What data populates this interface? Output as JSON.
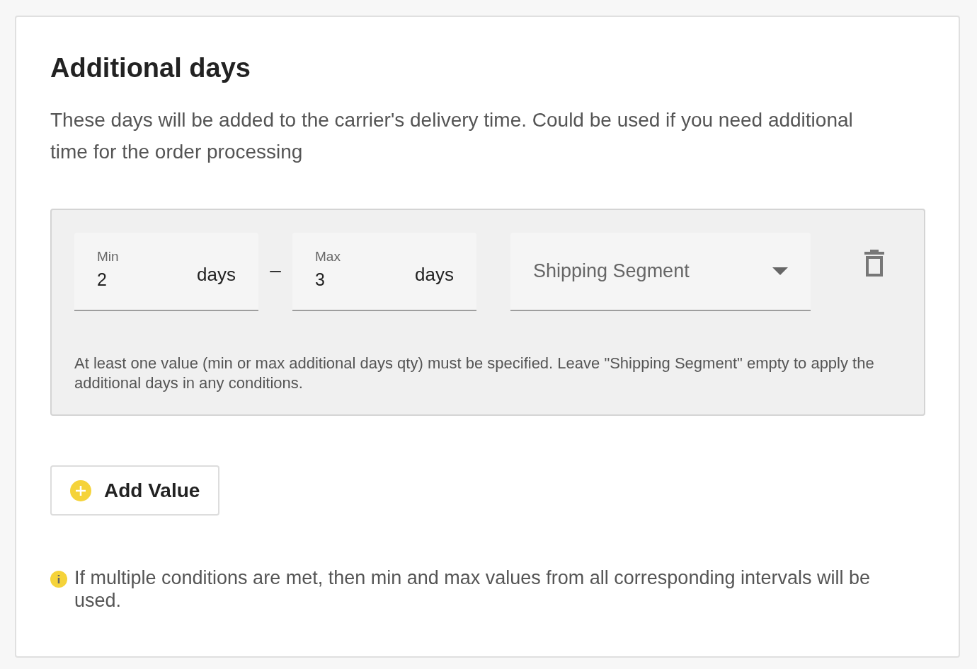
{
  "section": {
    "title": "Additional days",
    "description": "These days will be added to the carrier's delivery time. Could be used if you need additional time for the order processing"
  },
  "intervals": [
    {
      "min": {
        "label": "Min",
        "value": "2",
        "suffix": "days"
      },
      "separator": "–",
      "max": {
        "label": "Max",
        "value": "3",
        "suffix": "days"
      },
      "segment": {
        "placeholder": "Shipping Segment"
      },
      "hint": "At least one value (min or max additional days qty) must be specified. Leave \"Shipping Segment\" empty to apply the additional days in any conditions."
    }
  ],
  "add_button": {
    "label": "Add Value"
  },
  "note": {
    "text": "If multiple conditions are met, then min and max values from all corresponding intervals will be used."
  }
}
